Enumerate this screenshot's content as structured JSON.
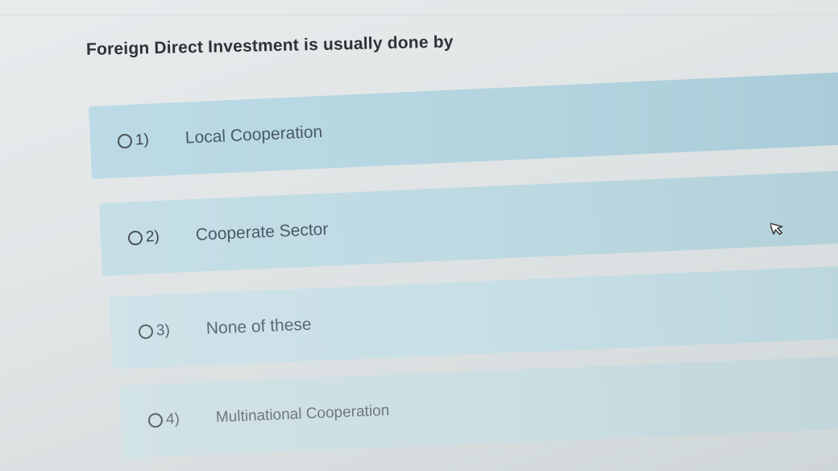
{
  "question": {
    "text": "Foreign Direct Investment is usually done by"
  },
  "options": [
    {
      "number": "1)",
      "label": "Local Cooperation"
    },
    {
      "number": "2)",
      "label": "Cooperate Sector"
    },
    {
      "number": "3)",
      "label": "None of these"
    },
    {
      "number": "4)",
      "label": "Multinational Cooperation"
    }
  ],
  "icons": {
    "cursor": "mouse-pointer-icon",
    "radio": "radio-unselected-icon"
  },
  "colors": {
    "option_bg": "#b8d7e2",
    "question_text": "#2e3336",
    "option_text": "#4a5a66"
  }
}
